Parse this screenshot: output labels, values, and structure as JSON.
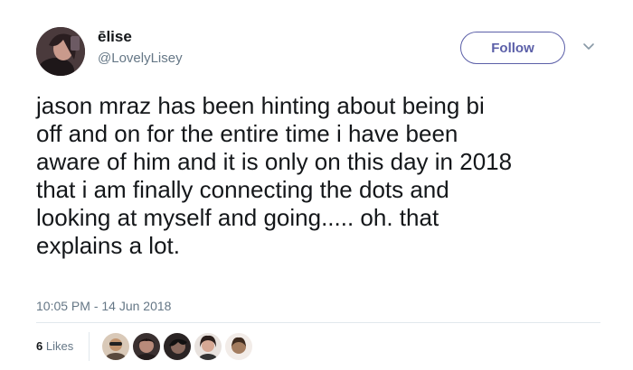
{
  "user": {
    "display_name": "ēlise",
    "handle": "@LovelyLisey"
  },
  "actions": {
    "follow_label": "Follow"
  },
  "tweet": {
    "lines": [
      "jason mraz has been hinting about being bi",
      "off and on for the entire time i have been",
      "aware of him and it is only on this day in 2018",
      "that i am finally connecting the dots and",
      "looking at myself and going..... oh. that",
      "explains a lot."
    ],
    "timestamp": "10:05 PM - 14 Jun 2018"
  },
  "engagement": {
    "likes_count": "6",
    "likes_label": "Likes"
  },
  "colors": {
    "follow_accent": "#5b5fa8",
    "muted_text": "#657786",
    "divider": "#e1e8ed"
  }
}
